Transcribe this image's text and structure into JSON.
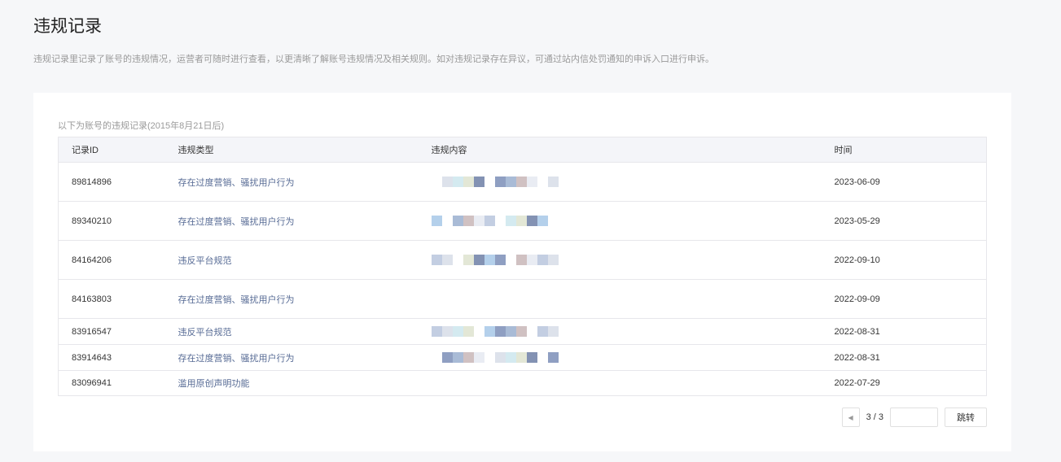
{
  "page": {
    "title": "违规记录",
    "description": "违规记录里记录了账号的违规情况，运营者可随时进行查看，以更清晰了解账号违规情况及相关规则。如对违规记录存在异议，可通过站内信处罚通知的申诉入口进行申诉。"
  },
  "table": {
    "caption": "以下为账号的违规记录(2015年8月21日后)",
    "headers": [
      "记录ID",
      "违规类型",
      "违规内容",
      "时间"
    ],
    "rows": [
      {
        "id": "89814896",
        "type": "存在过度营销、骚扰用户行为",
        "time": "2023-06-09"
      },
      {
        "id": "89340210",
        "type": "存在过度营销、骚扰用户行为",
        "time": "2023-05-29"
      },
      {
        "id": "84164206",
        "type": "违反平台规范",
        "time": "2022-09-10"
      },
      {
        "id": "84163803",
        "type": "存在过度营销、骚扰用户行为",
        "time": "2022-09-09"
      },
      {
        "id": "83916547",
        "type": "违反平台规范",
        "time": "2022-08-31"
      },
      {
        "id": "83914643",
        "type": "存在过度营销、骚扰用户行为",
        "time": "2022-08-31"
      },
      {
        "id": "83096941",
        "type": "滥用原创声明功能",
        "time": "2022-07-29"
      }
    ]
  },
  "pagination": {
    "current": "3 / 3",
    "jump_label": "跳转",
    "jump_value": ""
  }
}
